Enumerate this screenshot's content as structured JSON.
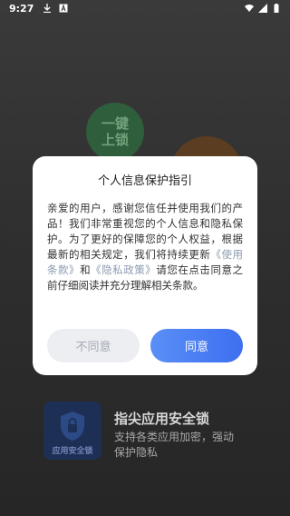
{
  "status_bar": {
    "time": "9:27",
    "left_icons": [
      "download-icon",
      "letter-a-icon"
    ],
    "right_icons": [
      "wifi-icon",
      "signal-icon",
      "battery-icon"
    ]
  },
  "background": {
    "bubble_green": {
      "line1": "一键",
      "line2": "上锁"
    },
    "feature": {
      "icon_label": "应用安全锁",
      "title": "指尖应用安全锁",
      "desc_line1": "支持各类应用加密，强动",
      "desc_line2": "保护隐私"
    }
  },
  "dialog": {
    "title": "个人信息保护指引",
    "body_part1": "亲爱的用户，感谢您信任并使用我们的产品！我们非常重视您的个人信息和隐私保护。为了更好的保障您的个人权益，根据最新的相关规定，我们将持续更新",
    "terms_link": "《使用条款》",
    "and": "和",
    "privacy_link": "《隐私政策》",
    "body_part2": "请您在点击同意之前仔细阅读并充分理解相关条款。",
    "disagree_label": "不同意",
    "agree_label": "同意"
  },
  "colors": {
    "agree_button": "#4a7ff3",
    "disagree_button": "#eceef2",
    "link": "#8c9ab0"
  }
}
